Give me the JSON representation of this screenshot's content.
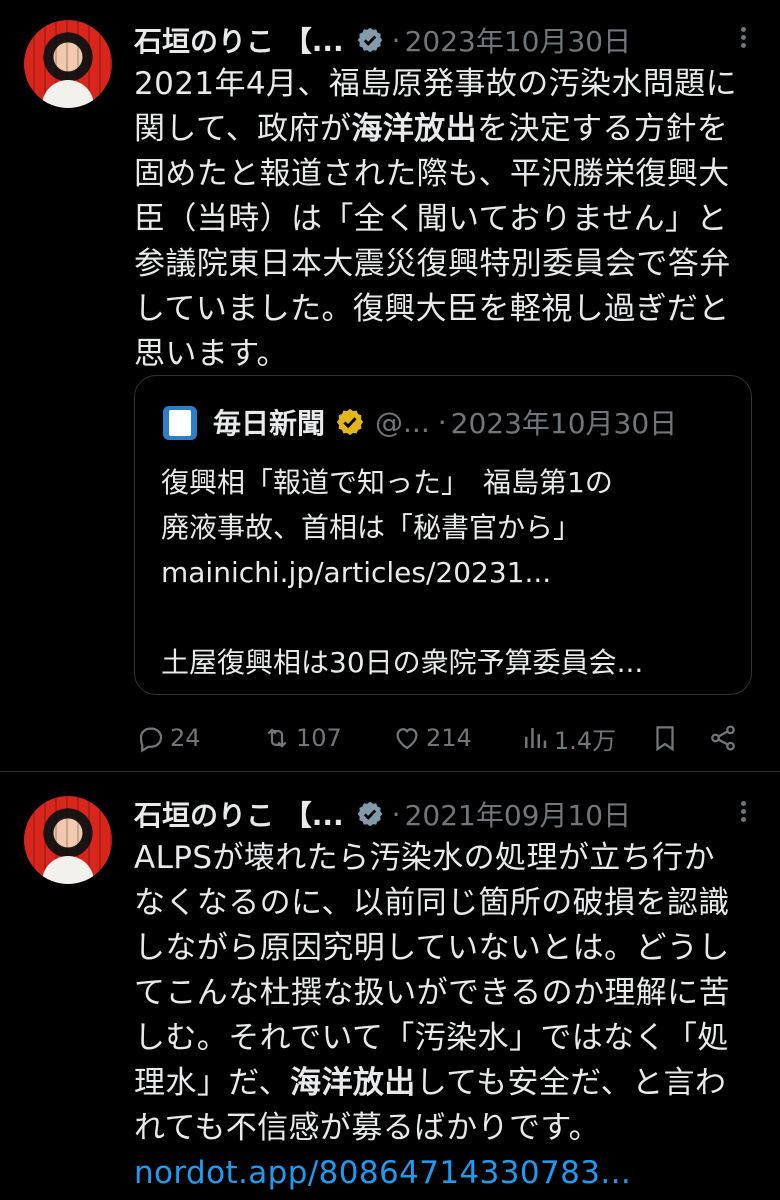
{
  "tweets": [
    {
      "author": "石垣のりこ 【...",
      "date": "2023年10月30日",
      "lines": [
        "2021年4月、福島原発事故の汚染水問題に",
        [
          "関して、政府が",
          "海洋放出",
          "を決定する方針を"
        ],
        "固めたと報道された際も、平沢勝栄復興大",
        "臣（当時）は「全く聞いておりません」と",
        "参議院東日本大震災復興特別委員会で答弁",
        "していました。復興大臣を軽視し過ぎだと",
        "思います。"
      ],
      "quote": {
        "source": "毎日新聞",
        "handle": "@...",
        "date": "2023年10月30日",
        "lines": [
          "復興相「報道で知った」　福島第1の",
          "廃液事故、首相は「秘書官から」",
          "mainichi.jp/articles/20231...",
          "",
          "土屋復興相は30日の衆院予算委員会..."
        ]
      },
      "actions": {
        "replies": "24",
        "reposts": "107",
        "likes": "214",
        "views": "1.4万"
      }
    },
    {
      "author": "石垣のりこ 【...",
      "date": "2021年09月10日",
      "lines": [
        "ALPSが壊れたら汚染水の処理が立ち行か",
        "なくなるのに、以前同じ箇所の破損を認識",
        "しながら原因究明していないとは。どうし",
        "てこんな杜撰な扱いができるのか理解に苦",
        "しむ。それでいて「汚染水」ではなく「処",
        [
          "理水」だ、",
          "海洋放出",
          "しても安全だ、と言わ"
        ],
        "れても不信感が募るばかりです。"
      ],
      "link": "nordot.app/80864714330783..."
    }
  ],
  "colors": {
    "background": "#000000",
    "text": "#e7e9ea",
    "muted": "#71767b",
    "link": "#1d9bf0",
    "badge_gray": "#829aab",
    "badge_gold": "#e2b719",
    "border": "#2f3336"
  }
}
